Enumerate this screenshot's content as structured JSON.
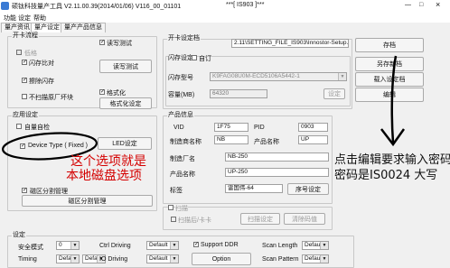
{
  "window": {
    "title": "硕钛科技量产工具 V2.11.00.39(2014/01/06)   V116_00_01101",
    "title_right": "***[ IS903 ]***",
    "min": "—",
    "max": "□",
    "close": "×"
  },
  "menu": [
    "功能",
    "设定",
    "帮助"
  ],
  "tabs": [
    "量产资讯",
    "量产设定",
    "量产产品信息"
  ],
  "groups": {
    "flow": "开卡流程",
    "app": "应用设定",
    "file": "开卡设定档",
    "product": "产品信息",
    "scan": "扫描",
    "settings": "设定"
  },
  "flow": {
    "lowlevel": "低格",
    "flash_compare": "闪存比对",
    "erase_flash": "擦除闪存",
    "skip_factory_bad": "不扫描原厂坏块",
    "read_test": "读写测试",
    "read_test_button": "读写测试",
    "format": "格式化",
    "format_button": "格式化设定"
  },
  "app": {
    "auto_test": "自量自检",
    "device_type": "Device Type ( Fixed )",
    "led_button": "LED设定",
    "disk_partition": "磁区分割管理",
    "disk_partition_button": "磁区分割管理"
  },
  "file": {
    "path": "2.11\\SETTING_FILE_IS903\\Innostor-Setup.ini",
    "flash_setting": "闪存设定",
    "custom": "自订",
    "flash_model_label": "闪存型号",
    "flash_model": "K9FAG08U0M-ECD5106A5442-1",
    "capacity_label": "容量(MB)",
    "capacity": "64320",
    "capacity_button": "设定"
  },
  "buttons": {
    "save": "存档",
    "save_as": "另存新档",
    "load": "载入设定档",
    "edit": "编辑"
  },
  "product": {
    "vid_label": "VID",
    "vid": "1F75",
    "pid_label": "PID",
    "pid": "0903",
    "vendor_name_label": "制造商名称",
    "vendor_name": "NB",
    "product_name_label": "产品名称",
    "product_name": "UP",
    "vendor_label": "制造厂名",
    "vendor": "NB-250",
    "product_label": "产品名称",
    "product": "UP-250",
    "tag_label": "标签",
    "tag": "雷国伟-64",
    "serial_button": "序号设定"
  },
  "scan": {
    "scan_label": "扫描",
    "option_label": "扫描后/卡卡",
    "button1": "扫描设定",
    "button2": "清除码值"
  },
  "settings": {
    "safe_mode_label": "安全模式",
    "safe_mode": "0",
    "ctrl_driving_label": "Ctrl Driving",
    "ctrl_driving": "Default",
    "support_ddr": "Support DDR",
    "scan_length_label": "Scan Length",
    "scan_length": "Default",
    "timing_label": "Timing",
    "timing": "Default",
    "timing2": "Default",
    "io_driving_label": "IO Driving",
    "io_driving": "Default",
    "option_button": "Option",
    "scan_pattern_label": "Scan Pattern",
    "scan_pattern": "Default"
  },
  "annotations": {
    "red_line1": "这个选项就是",
    "red_line2": "本地磁盘选项",
    "black_line1": "点击编辑要求输入密码",
    "black_line2": "密码是IS0024  大写"
  }
}
